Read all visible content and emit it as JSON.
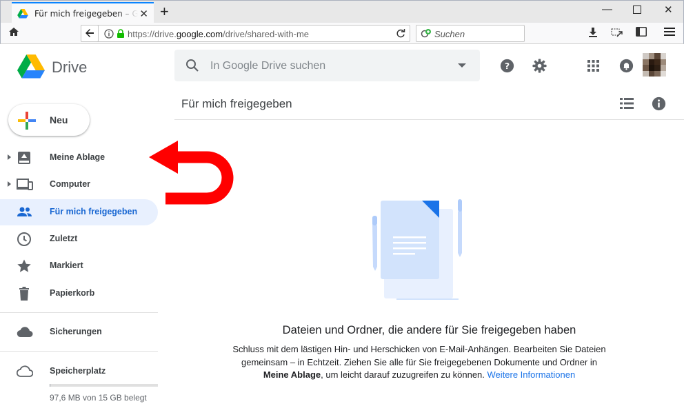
{
  "browser": {
    "tab_title": "Für mich freigegeben – Google Drive",
    "url_prefix": "https://drive.",
    "url_domain": "google.com",
    "url_path": "/drive/shared-with-me",
    "search_placeholder": "Suchen"
  },
  "header": {
    "brand": "Drive",
    "search_placeholder": "In Google Drive suchen"
  },
  "sidebar": {
    "new_label": "Neu",
    "items": [
      {
        "label": "Meine Ablage",
        "icon": "my-drive-icon",
        "expandable": true
      },
      {
        "label": "Computer",
        "icon": "computers-icon",
        "expandable": true
      },
      {
        "label": "Für mich freigegeben",
        "icon": "shared-icon",
        "active": true
      },
      {
        "label": "Zuletzt",
        "icon": "recent-icon"
      },
      {
        "label": "Markiert",
        "icon": "star-icon"
      },
      {
        "label": "Papierkorb",
        "icon": "trash-icon"
      }
    ],
    "backups_label": "Sicherungen",
    "storage_label": "Speicherplatz",
    "storage_text": "97,6 MB von 15 GB belegt",
    "storage_fraction": 0.0065
  },
  "main": {
    "title": "Für mich freigegeben",
    "empty_title": "Dateien und Ordner, die andere für Sie freigegeben haben",
    "empty_text_1": "Schluss mit dem lästigen Hin- und Herschicken von E-Mail-Anhängen. Bearbeiten Sie Dateien gemeinsam – in Echtzeit. Ziehen Sie alle für Sie freigegebenen Dokumente und Ordner in ",
    "empty_text_bold": "Meine Ablage",
    "empty_text_2": ", um leicht darauf zuzugreifen zu können. ",
    "empty_link": "Weitere Informationen"
  },
  "colors": {
    "accent": "#1967d2",
    "active_bg": "#e8f0fe",
    "annotation_arrow": "#ff0000"
  }
}
